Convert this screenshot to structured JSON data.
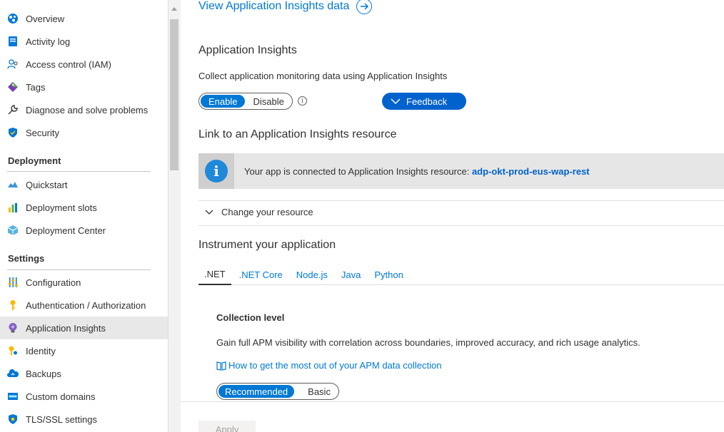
{
  "sidebar": {
    "items_top": [
      {
        "label": "Overview",
        "icon": "overview-icon"
      },
      {
        "label": "Activity log",
        "icon": "activity-log-icon"
      },
      {
        "label": "Access control (IAM)",
        "icon": "people-icon"
      },
      {
        "label": "Tags",
        "icon": "tag-icon"
      },
      {
        "label": "Diagnose and solve problems",
        "icon": "wrench-icon"
      },
      {
        "label": "Security",
        "icon": "shield-icon"
      }
    ],
    "section_deployment": "Deployment",
    "items_deployment": [
      {
        "label": "Quickstart",
        "icon": "cloud-icon"
      },
      {
        "label": "Deployment slots",
        "icon": "bar-chart-icon"
      },
      {
        "label": "Deployment Center",
        "icon": "cube-icon"
      }
    ],
    "section_settings": "Settings",
    "items_settings": [
      {
        "label": "Configuration",
        "icon": "sliders-icon"
      },
      {
        "label": "Authentication / Authorization",
        "icon": "key-icon"
      },
      {
        "label": "Application Insights",
        "icon": "lightbulb-icon",
        "active": true
      },
      {
        "label": "Identity",
        "icon": "identity-key-icon"
      },
      {
        "label": "Backups",
        "icon": "backup-cloud-icon"
      },
      {
        "label": "Custom domains",
        "icon": "domain-icon"
      },
      {
        "label": "TLS/SSL settings",
        "icon": "ssl-shield-icon"
      }
    ]
  },
  "main": {
    "view_link": "View Application Insights data",
    "section_title": "Application Insights",
    "section_desc": "Collect application monitoring data using Application Insights",
    "toggle_enable": "Enable",
    "toggle_disable": "Disable",
    "toggle_selected": "Enable",
    "feedback_label": "Feedback",
    "link_title": "Link to an Application Insights resource",
    "info_message": "Your app is connected to Application Insights resource: ",
    "info_resource": "adp-okt-prod-eus-wap-rest",
    "change_resource": "Change your resource",
    "instrument_title": "Instrument your application",
    "tabs": [
      ".NET",
      ".NET Core",
      "Node.js",
      "Java",
      "Python"
    ],
    "active_tab": ".NET",
    "collection_title": "Collection level",
    "collection_desc": "Gain full APM visibility with correlation across boundaries, improved accuracy, and rich usage analytics.",
    "apm_link": "How to get the most out of your APM data collection",
    "level_recommended": "Recommended",
    "level_basic": "Basic",
    "level_selected": "Recommended",
    "apply_label": "Apply"
  },
  "colors": {
    "accent": "#0078d4",
    "feedback_bg": "#0062cc",
    "info_icon": "#1f88d9",
    "active_nav_bg": "#e8e8e8"
  }
}
